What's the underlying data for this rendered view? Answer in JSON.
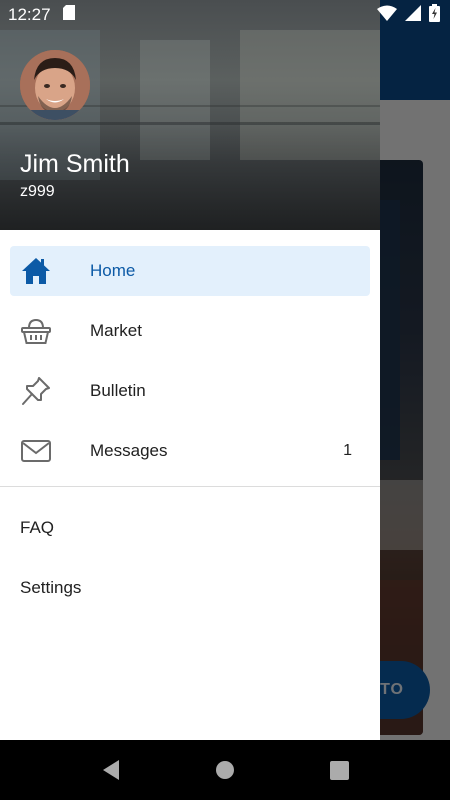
{
  "status_bar": {
    "time": "12:27"
  },
  "drawer": {
    "header": {
      "name": "Jim Smith",
      "user_id": "z999"
    },
    "nav_items": [
      {
        "label": "Home",
        "icon": "home-icon",
        "active": true,
        "badge": ""
      },
      {
        "label": "Market",
        "icon": "basket-icon",
        "active": false,
        "badge": ""
      },
      {
        "label": "Bulletin",
        "icon": "pushpin-icon",
        "active": false,
        "badge": ""
      },
      {
        "label": "Messages",
        "icon": "envelope-icon",
        "active": false,
        "badge": "1"
      }
    ],
    "secondary_items": [
      {
        "label": "FAQ"
      },
      {
        "label": "Settings"
      }
    ]
  },
  "background_app": {
    "fab_label": "TO"
  },
  "colors": {
    "accent": "#0c5aa6",
    "active_bg": "#e3f0fc",
    "toolbar": "#0b4a8b"
  }
}
